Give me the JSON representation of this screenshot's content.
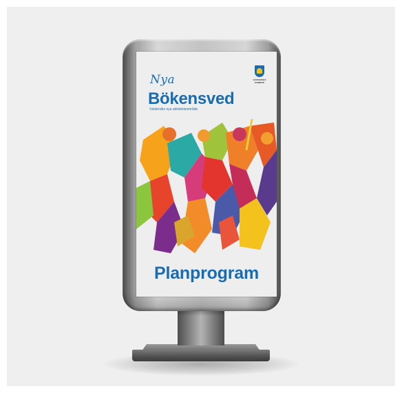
{
  "poster": {
    "nya": "Nya",
    "title": "Bökensved",
    "subtitle": "Västerviks nya aktivitetsområde",
    "headline": "Planprogram",
    "logo": {
      "text": "VÄSTERVIKS KOMMUN",
      "icon": "municipal-crest-icon"
    }
  },
  "colors": {
    "brand_blue": "#1a6cb0",
    "crest_yellow": "#f2c316"
  }
}
